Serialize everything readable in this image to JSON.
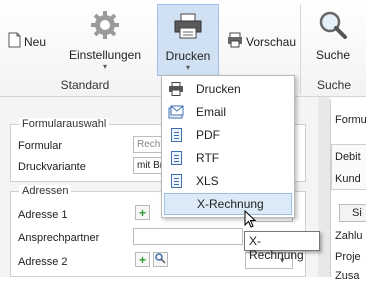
{
  "ribbon": {
    "neu_label": "Neu",
    "einstellungen_label": "Einstellungen",
    "drucken_label": "Drucken",
    "vorschau_label": "Vorschau",
    "suche_label": "Suche",
    "group_standard": "Standard",
    "group_suche": "Suche"
  },
  "formular": {
    "section_title": "Formularauswahl",
    "formular_label": "Formular",
    "formular_value": "Rech",
    "druckvariante_label": "Druckvariante",
    "druckvariante_value": "mit Br"
  },
  "adressen": {
    "section_title": "Adressen",
    "adresse1_label": "Adresse 1",
    "ansprechpartner_label": "Ansprechpartner",
    "adresse2_label": "Adresse 2"
  },
  "right_panel": {
    "title": "Formu",
    "debit": "Debit",
    "kunde": "Kund",
    "si": "Si",
    "zahlu": "Zahlu",
    "proje": "Proje",
    "zusa": "Zusa"
  },
  "dropdown": {
    "items": [
      {
        "label": "Drucken",
        "icon": "printer-icon"
      },
      {
        "label": "Email",
        "icon": "email-icon"
      },
      {
        "label": "PDF",
        "icon": "document-icon"
      },
      {
        "label": "RTF",
        "icon": "document-icon"
      },
      {
        "label": "XLS",
        "icon": "document-icon"
      },
      {
        "label": "X-Rechnung",
        "icon": "none"
      }
    ]
  },
  "tooltip": "X-Rechnung",
  "colors": {
    "accent": "#cfe1f3",
    "highlight": "#dce9f7",
    "icon_blue": "#3d6fb0"
  }
}
